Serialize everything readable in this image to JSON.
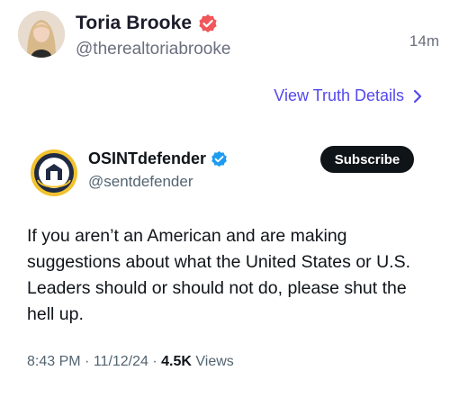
{
  "truth_post": {
    "author_name": "Toria Brooke",
    "author_handle": "@therealtoriabrooke",
    "time_ago": "14m",
    "verified_icon": "truth-verified-badge-icon",
    "view_details_label": "View Truth Details",
    "accent_color": "#5448ee",
    "verified_color": "#f0565a"
  },
  "embedded_tweet": {
    "author_name": "OSINTdefender",
    "author_handle": "@sentdefender",
    "verified_icon": "x-verified-badge-icon",
    "verified_color": "#1d9bf0",
    "subscribe_label": "Subscribe",
    "text": "If you aren’t an American and are making suggestions about what the United States or U.S. Leaders should or should not do, please shut the hell up.",
    "time": "8:43 PM",
    "separator": "·",
    "date": "11/12/24",
    "views_count": "4.5K",
    "views_label": "Views"
  }
}
